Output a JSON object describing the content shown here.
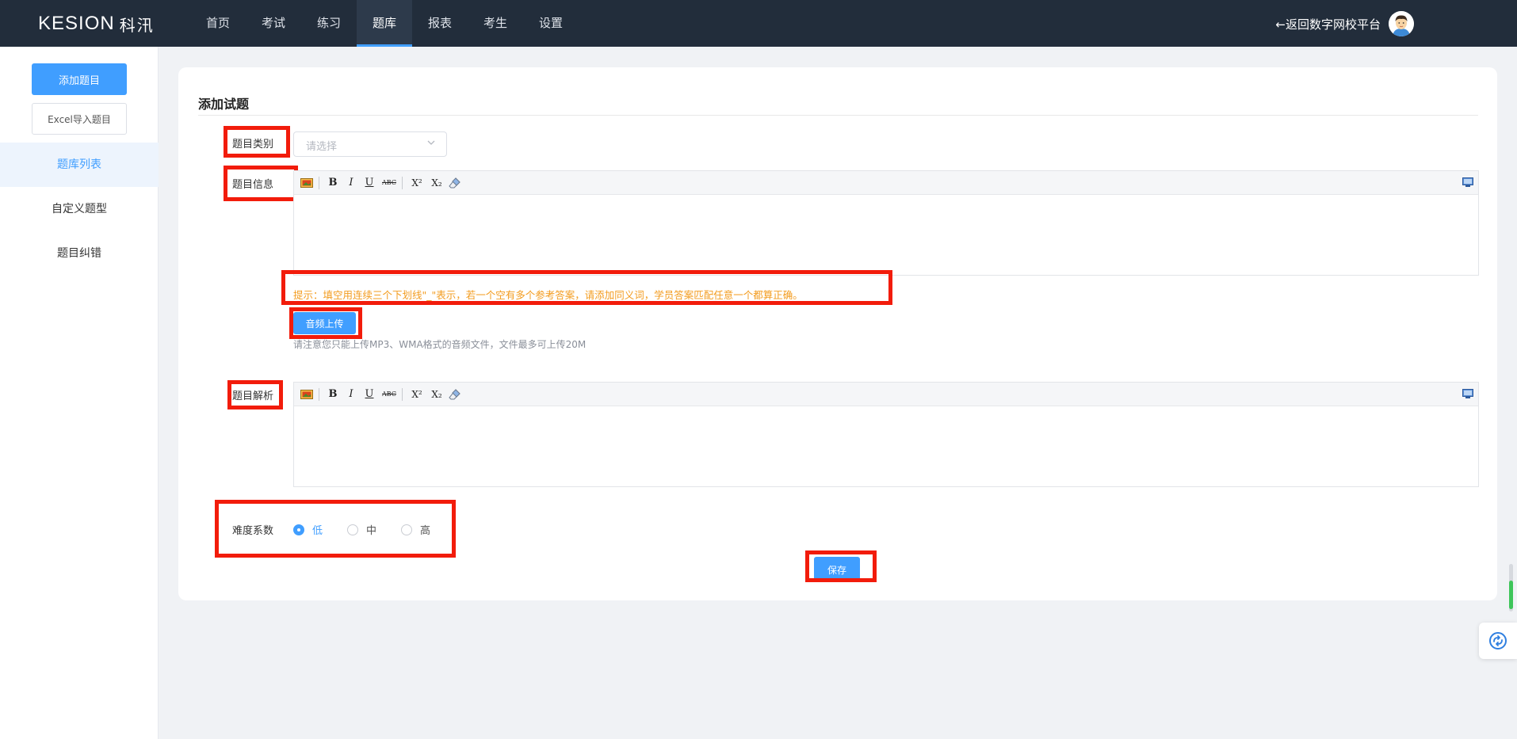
{
  "header": {
    "logo_en": "KESION",
    "logo_cn": "科汛",
    "nav": [
      {
        "label": "首页"
      },
      {
        "label": "考试"
      },
      {
        "label": "练习"
      },
      {
        "label": "题库"
      },
      {
        "label": "报表"
      },
      {
        "label": "考生"
      },
      {
        "label": "设置"
      }
    ],
    "active_nav": "题库",
    "back_link": "←返回数字网校平台"
  },
  "sidebar": {
    "add_button": "添加题目",
    "import_button": "Excel导入题目",
    "items": [
      {
        "label": "题库列表"
      },
      {
        "label": "自定义题型"
      },
      {
        "label": "题目纠错"
      }
    ],
    "active_item": "题库列表"
  },
  "form": {
    "title": "添加试题",
    "category_label": "题目类别",
    "category_placeholder": "请选择",
    "info_label": "题目信息",
    "hint": "提示：填空用连续三个下划线\"_\"表示，若一个空有多个参考答案，请添加同义词，学员答案匹配任意一个都算正确。",
    "audio_button": "音频上传",
    "audio_note": "请注意您只能上传MP3、WMA格式的音频文件，文件最多可上传20M",
    "analysis_label": "题目解析",
    "difficulty_label": "难度系数",
    "difficulty_options": [
      {
        "label": "低",
        "checked": true
      },
      {
        "label": "中",
        "checked": false
      },
      {
        "label": "高",
        "checked": false
      }
    ],
    "save_button": "保存"
  },
  "toolbar": {
    "bold": "B",
    "italic": "I",
    "underline": "U",
    "strike": "ABC",
    "superscript": "X²",
    "subscript": "X₂"
  },
  "colors": {
    "accent": "#409eff",
    "topbar": "#222d3b",
    "highlight": "#f21c0b",
    "hint": "#f39c1f"
  }
}
